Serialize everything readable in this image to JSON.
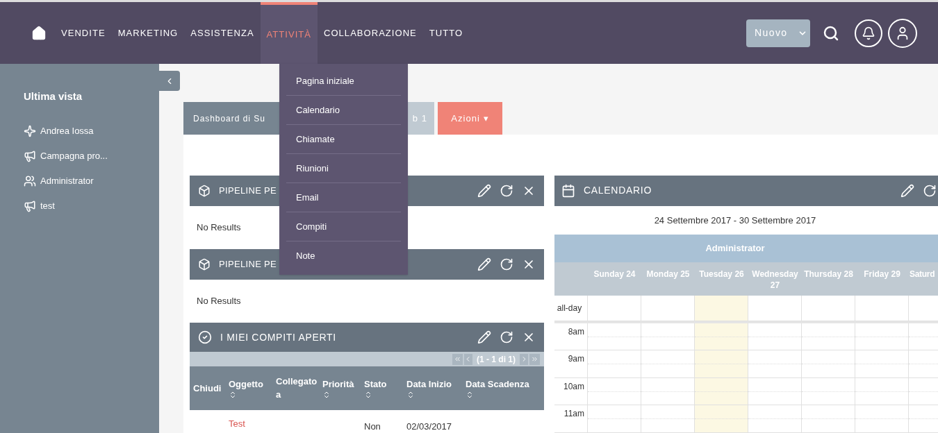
{
  "nav": {
    "items": [
      {
        "label": "VENDITE",
        "selected": false
      },
      {
        "label": "MARKETING",
        "selected": false
      },
      {
        "label": "ASSISTENZA",
        "selected": false
      },
      {
        "label": "ATTIVITÀ",
        "selected": true
      },
      {
        "label": "COLLABORAZIONE",
        "selected": false
      },
      {
        "label": "TUTTO",
        "selected": false
      }
    ],
    "new_button": "Nuovo"
  },
  "dropdown": [
    "Pagina iniziale",
    "Calendario",
    "Chiamate",
    "Riunioni",
    "Email",
    "Compiti",
    "Note"
  ],
  "sidebar": {
    "title": "Ultima vista",
    "items": [
      {
        "kind": "star",
        "label": "Andrea Iossa"
      },
      {
        "kind": "megaphone",
        "label": "Campagna pro..."
      },
      {
        "kind": "users",
        "label": "Administrator"
      },
      {
        "kind": "megaphone",
        "label": "test"
      }
    ]
  },
  "tabs": [
    {
      "label": "Dashboard di Su",
      "selected": true
    },
    {
      "label": "b 1",
      "selected": false
    }
  ],
  "actions_button": "Azioni ▾",
  "dashlets": [
    {
      "kind": "cube",
      "title": "PIPELINE PE",
      "message": "No Results"
    },
    {
      "kind": "cube",
      "title": "PIPELINE PE",
      "message": "No Results"
    }
  ],
  "tasks": {
    "title": "I MIEI COMPITI APERTI",
    "pagination": "(1 - 1 di 1)",
    "columns": [
      {
        "label": "Chiudi",
        "sortable": false
      },
      {
        "label": "Oggetto",
        "sortable": true
      },
      {
        "label": "Collegato a",
        "sortable": false
      },
      {
        "label": "Priorità",
        "sortable": true
      },
      {
        "label": "Stato",
        "sortable": true
      },
      {
        "label": "Data Inizio",
        "sortable": true
      },
      {
        "label": "Data Scadenza",
        "sortable": true
      }
    ],
    "row": {
      "subject": "Test",
      "status": "Non",
      "start": "02/03/2017"
    }
  },
  "calendar": {
    "title": "CALENDARIO",
    "range": "24 Settembre 2017 - 30 Settembre 2017",
    "user": "Administrator",
    "days": [
      {
        "label": "Sunday 24",
        "today": false
      },
      {
        "label": "Monday 25",
        "today": false
      },
      {
        "label": "Tuesday 26",
        "today": true
      },
      {
        "label": "Wednesday 27",
        "today": false
      },
      {
        "label": "Thursday 28",
        "today": false
      },
      {
        "label": "Friday 29",
        "today": false
      },
      {
        "label": "Saturd",
        "today": false
      }
    ],
    "rows": [
      "all-day",
      "8am",
      "9am",
      "10am",
      "11am"
    ]
  }
}
